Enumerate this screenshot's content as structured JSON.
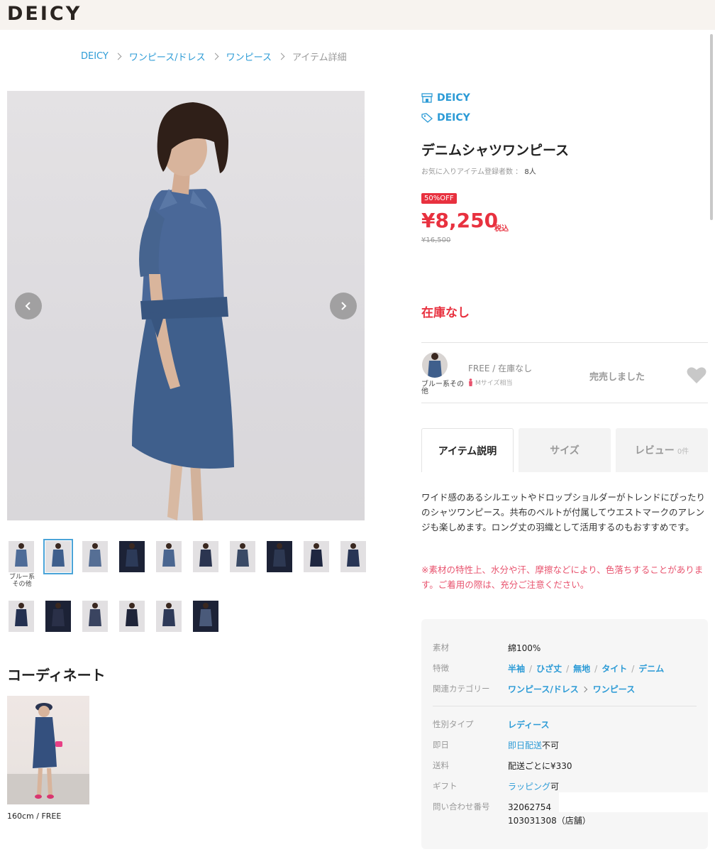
{
  "header": {
    "logo": "DEICY"
  },
  "breadcrumb": {
    "items": [
      "DEICY",
      "ワンピース/ドレス",
      "ワンピース"
    ],
    "current": "アイテム詳細"
  },
  "gallery": {
    "thumb_caption": "ブルー系その他",
    "thumb_colors": [
      "#4e6c98",
      "#3f5f8c",
      "#566f95",
      "#2c3a58",
      "#4a6690",
      "#2b3550",
      "#3a4a66",
      "#2d3852",
      "#1f2740",
      "#283555",
      "#233050",
      "#2a3048",
      "#3a4460",
      "#1e2438",
      "#2e3a58",
      "#4a5a7a"
    ]
  },
  "coordinate": {
    "title": "コーディネート",
    "caption": "160cm / FREE"
  },
  "product": {
    "shop": "DEICY",
    "brand": "DEICY",
    "title": "デニムシャツワンピース",
    "fav_label": "お気に入りアイテム登録者数 ：",
    "fav_count": "8人",
    "discount": "50%OFF",
    "price": "¥8,250",
    "tax": "税込",
    "original_price": "¥16,500",
    "stock_status": "在庫なし"
  },
  "sku": {
    "color": "ブルー系その他",
    "size_status": "FREE / 在庫なし",
    "fit": "Mサイズ相当",
    "sold_out": "完売しました"
  },
  "tabs": [
    {
      "label": "アイテム説明"
    },
    {
      "label": "サイズ"
    },
    {
      "label": "レビュー",
      "count": "0件"
    }
  ],
  "description": "ワイド感のあるシルエットやドロップショルダーがトレンドにぴったりのシャツワンピース。共布のベルトが付属してウエストマークのアレンジも楽しめます。ロング丈の羽織として活用するのもおすすめです。",
  "warning": "※素材の特性上、水分や汗、摩擦などにより、色落ちすることがあります。ご着用の際は、充分ご注意ください。",
  "specs": {
    "material_label": "素材",
    "material": "綿100%",
    "features_label": "特徴",
    "features": [
      "半袖",
      "ひざ丈",
      "無地",
      "タイト",
      "デニム"
    ],
    "category_label": "関連カテゴリー",
    "categories": [
      "ワンピース/ドレス",
      "ワンピース"
    ],
    "gender_label": "性別タイプ",
    "gender": "レディース",
    "sameday_label": "即日",
    "sameday_link": "即日配送",
    "sameday_suffix": "不可",
    "shipping_label": "送料",
    "shipping": "配送ごとに¥330",
    "gift_label": "ギフト",
    "gift_link": "ラッピング",
    "gift_suffix": "可",
    "inquiry_label": "問い合わせ番号",
    "inquiry_1": "32062754",
    "inquiry_2": "103031308（店舗）"
  },
  "colors": {
    "accent": "#2c9bd6",
    "sale": "#e8313f",
    "denim": "#3f5f8c"
  }
}
